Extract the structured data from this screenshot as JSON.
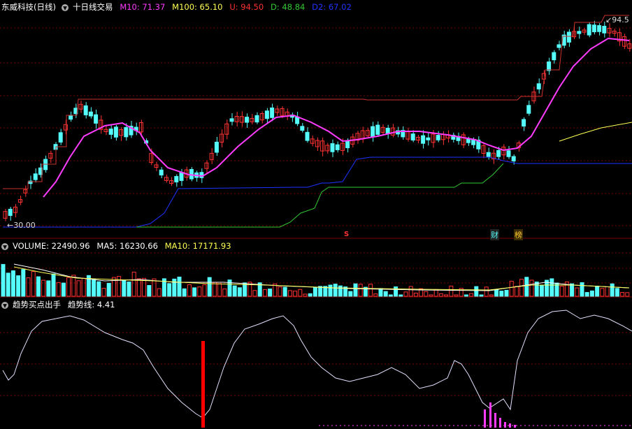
{
  "price_header": {
    "stock": "东威科技(日线)",
    "formula": "十日线交易",
    "m10": "M10: 71.37",
    "m100": "M100: 65.10",
    "u": "U: 94.50",
    "d": "D: 48.84",
    "d2": "D2: 67.02"
  },
  "price_labels": {
    "high": "94.5",
    "low": "30.00",
    "marker_s": "S",
    "badge_cai": "财",
    "badge_bang": "榜"
  },
  "volume_header": {
    "volume": "VOLUME: 22490.96",
    "ma5": "MA5: 16230.66",
    "ma10": "MA10: 17171.93"
  },
  "indicator_header": {
    "name": "趋势买点出手",
    "trend": "趋势线: 4.41"
  },
  "colors": {
    "up": "#ff3232",
    "down": "#54fcfc",
    "ma_pink": "#ff3cff",
    "ma_yellow": "#ffff54",
    "blue": "#1e32ff",
    "green": "#32c832",
    "grid": "#7a0000"
  }
}
